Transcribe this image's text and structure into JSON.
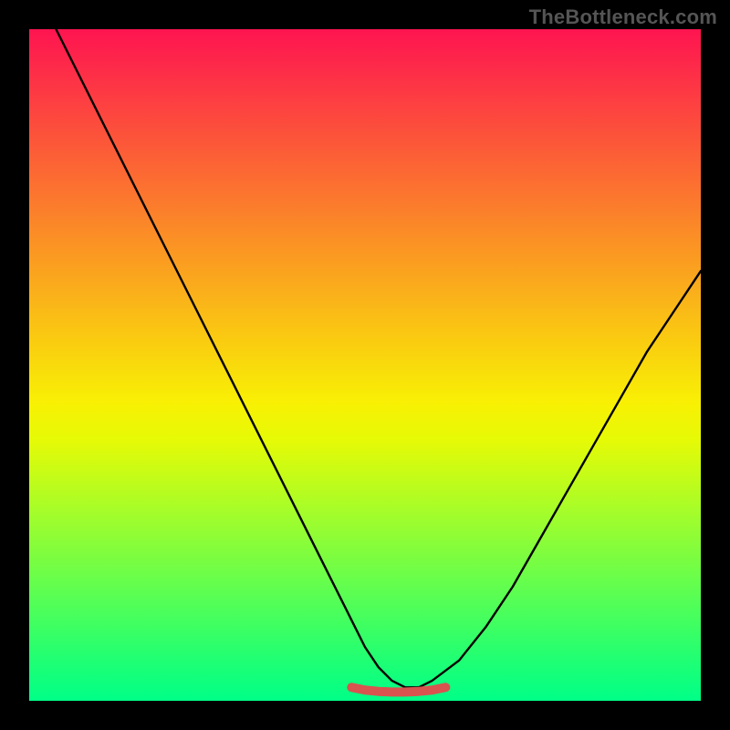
{
  "watermark": {
    "text": "TheBottleneck.com"
  },
  "chart_data": {
    "type": "line",
    "title": "",
    "xlabel": "",
    "ylabel": "",
    "xlim": [
      0,
      100
    ],
    "ylim": [
      0,
      100
    ],
    "grid": false,
    "legend": false,
    "background_gradient_stops_top_to_bottom": [
      "#fe1450",
      "#fd2a49",
      "#fd4041",
      "#fc5639",
      "#fc6c32",
      "#fb822a",
      "#fb9822",
      "#faae1b",
      "#fac413",
      "#f9da0c",
      "#f9f004",
      "#e6fa06",
      "#c4fc18",
      "#a3fd2b",
      "#81fd3d",
      "#60fe50",
      "#3eff62",
      "#1dff75",
      "#00ff87"
    ],
    "series": [
      {
        "name": "main-curve",
        "color": "#000000",
        "x": [
          4,
          8,
          12,
          16,
          20,
          24,
          28,
          32,
          36,
          40,
          44,
          48,
          50,
          52,
          54,
          56,
          58,
          60,
          64,
          68,
          72,
          76,
          80,
          84,
          88,
          92,
          96,
          100
        ],
        "y": [
          100,
          92,
          84,
          76,
          68,
          60,
          52,
          44,
          36,
          28,
          20,
          12,
          8,
          5,
          3,
          2,
          2,
          3,
          6,
          11,
          17,
          24,
          31,
          38,
          45,
          52,
          58,
          64
        ]
      },
      {
        "name": "bottom-marker-band",
        "color": "#d9534f",
        "stroke_width_px": 10,
        "x": [
          48,
          50,
          52,
          54,
          56,
          58,
          60,
          62
        ],
        "y": [
          2.0,
          1.6,
          1.4,
          1.3,
          1.3,
          1.4,
          1.6,
          2.0
        ]
      }
    ]
  }
}
